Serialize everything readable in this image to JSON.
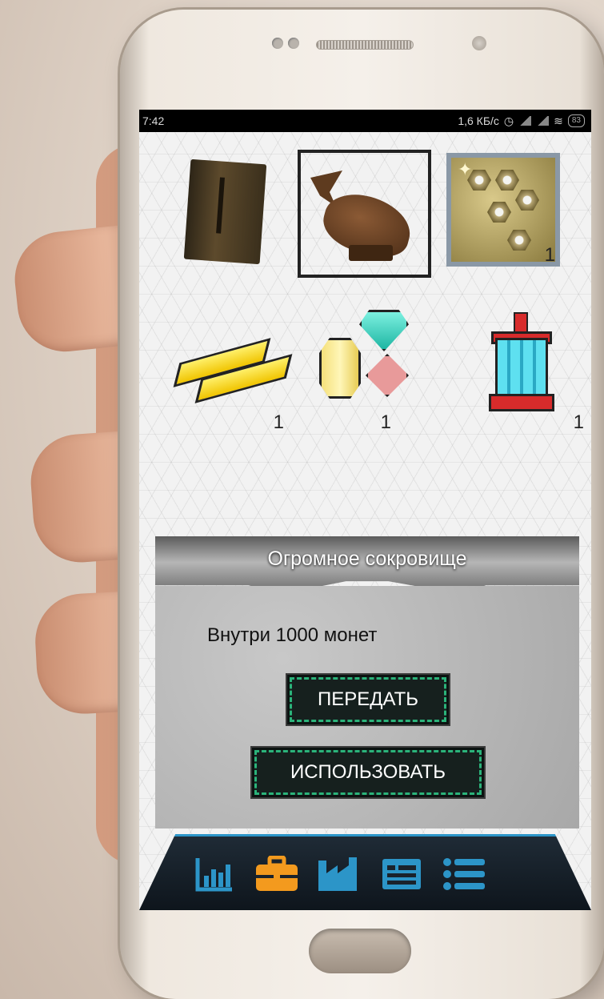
{
  "statusbar": {
    "time": "7:42",
    "network_speed": "1,6 КБ/с",
    "battery": "83"
  },
  "inventory": {
    "items": [
      {
        "name": "pouch",
        "count": ""
      },
      {
        "name": "whale-figurine",
        "count": "",
        "selected": true
      },
      {
        "name": "bolts",
        "count": "1"
      },
      {
        "name": "gold-bars",
        "count": "1"
      },
      {
        "name": "gems",
        "count": "1"
      },
      {
        "name": "lantern",
        "count": "1"
      }
    ]
  },
  "dialog": {
    "title": "Огромное сокровище",
    "description": "Внутри 1000 монет",
    "transfer_label": "ПЕРЕДАТЬ",
    "use_label": "ИСПОЛЬЗОВАТЬ"
  },
  "navbar": {
    "icons": [
      "chart-icon",
      "briefcase-icon",
      "factory-icon",
      "list-card-icon",
      "menu-list-icon"
    ],
    "active": "briefcase-icon",
    "colors": {
      "accent": "#2c95c8",
      "active": "#f39a1e"
    }
  }
}
